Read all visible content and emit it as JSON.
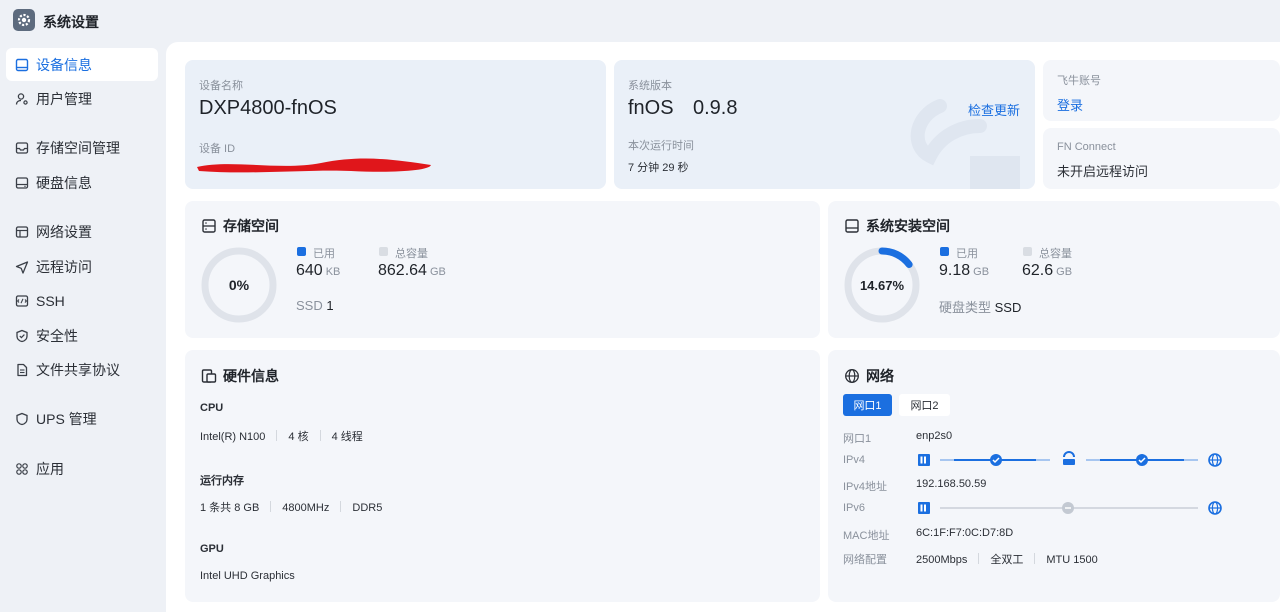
{
  "app": {
    "title": "系统设置",
    "icon": "gear-icon"
  },
  "sidebar": {
    "items": [
      {
        "label": "设备信息",
        "icon": "monitor-icon",
        "active": true
      },
      {
        "label": "用户管理",
        "icon": "user-icon"
      },
      {
        "label": "存储空间管理",
        "icon": "storage-icon"
      },
      {
        "label": "硬盘信息",
        "icon": "disk-icon"
      },
      {
        "label": "网络设置",
        "icon": "network-icon"
      },
      {
        "label": "远程访问",
        "icon": "send-icon"
      },
      {
        "label": "SSH",
        "icon": "terminal-icon"
      },
      {
        "label": "安全性",
        "icon": "shield-icon"
      },
      {
        "label": "文件共享协议",
        "icon": "file-icon"
      },
      {
        "label": "UPS 管理",
        "icon": "ups-icon"
      },
      {
        "label": "应用",
        "icon": "apps-icon"
      }
    ]
  },
  "device": {
    "name_label": "设备名称",
    "name": "DXP4800-fnOS",
    "id_label": "设备 ID"
  },
  "system": {
    "version_label": "系统版本",
    "os_name": "fnOS",
    "version": "0.9.8",
    "check_update": "检查更新",
    "uptime_label": "本次运行时间",
    "uptime": "7 分钟 29 秒"
  },
  "account": {
    "label": "飞牛账号",
    "login": "登录"
  },
  "fnconnect": {
    "label": "FN Connect",
    "status": "未开启远程访问"
  },
  "storage": {
    "title": "存储空间",
    "percent_text": "0%",
    "used_fraction": 0.0,
    "used_label": "已用",
    "used_value": "640",
    "used_unit": "KB",
    "total_label": "总容量",
    "total_value": "862.64",
    "total_unit": "GB",
    "ssd_label": "SSD",
    "ssd_count": "1"
  },
  "sysdisk": {
    "title": "系统安装空间",
    "percent_text": "14.67%",
    "used_fraction": 0.1467,
    "used_label": "已用",
    "used_value": "9.18",
    "used_unit": "GB",
    "total_label": "总容量",
    "total_value": "62.6",
    "total_unit": "GB",
    "type_label": "硬盘类型",
    "type_value": "SSD"
  },
  "hardware": {
    "title": "硬件信息",
    "cpu_label": "CPU",
    "cpu_model": "Intel(R) N100",
    "cpu_cores": "4 核",
    "cpu_threads": "4 线程",
    "mem_label": "运行内存",
    "mem_size": "1 条共 8 GB",
    "mem_freq": "4800MHz",
    "mem_type": "DDR5",
    "gpu_label": "GPU",
    "gpu_model": "Intel UHD Graphics"
  },
  "network": {
    "title": "网络",
    "tabs": [
      "网口1",
      "网口2"
    ],
    "port_label": "网口1",
    "port_value": "enp2s0",
    "ipv4_label": "IPv4",
    "ipv4_addr_label": "IPv4地址",
    "ipv4_addr": "192.168.50.59",
    "ipv6_label": "IPv6",
    "mac_label": "MAC地址",
    "mac": "6C:1F:F7:0C:D7:8D",
    "config_label": "网络配置",
    "speed": "2500Mbps",
    "duplex": "全双工",
    "mtu": "MTU 1500"
  },
  "colors": {
    "accent": "#1b6fe0",
    "ring_track": "#dfe3ea",
    "legend_total": "#d9dde3",
    "redaction": "#e0161b"
  }
}
